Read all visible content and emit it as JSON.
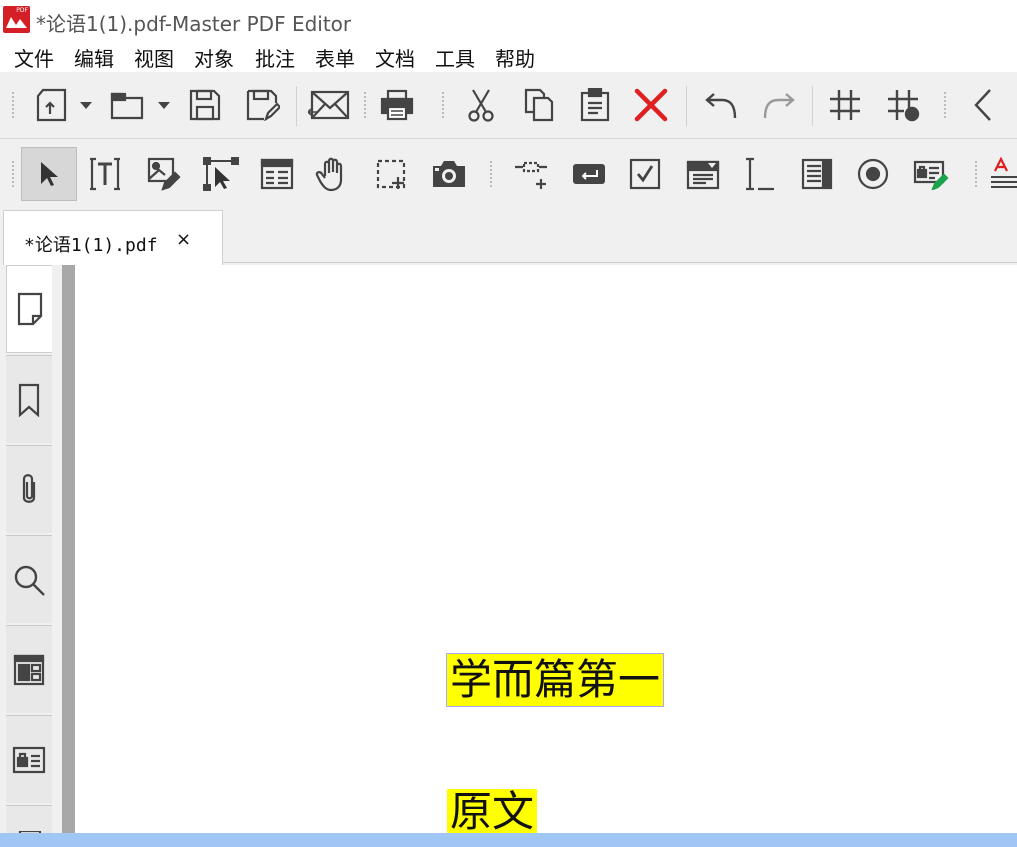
{
  "window": {
    "title": "*论语1(1).pdf-Master PDF Editor"
  },
  "menu": [
    "文件",
    "编辑",
    "视图",
    "对象",
    "批注",
    "表单",
    "文档",
    "工具",
    "帮助"
  ],
  "toolbar_main_icons": [
    "new-document-icon",
    "open-folder-icon",
    "save-icon",
    "save-as-icon",
    "email-icon",
    "print-icon",
    "cut-icon",
    "copy-icon",
    "paste-icon",
    "delete-icon",
    "undo-icon",
    "redo-icon",
    "grid-icon",
    "snap-to-grid-icon",
    "collapse-arrow-icon"
  ],
  "toolbar_tools_icons": [
    "select-pointer-icon",
    "text-edit-icon",
    "image-edit-icon",
    "object-select-icon",
    "form-table-icon",
    "hand-pan-icon",
    "marquee-select-icon",
    "snapshot-camera-icon",
    "link-insert-icon",
    "button-field-icon",
    "checkbox-field-icon",
    "combobox-field-icon",
    "text-field-icon",
    "listbox-field-icon",
    "radio-button-icon",
    "signature-field-icon",
    "text-annotation-icon"
  ],
  "tab": {
    "label": "*论语1(1).pdf",
    "close": "×"
  },
  "sidebar": [
    "pages-icon",
    "bookmarks-icon",
    "attachments-icon",
    "search-icon",
    "layers-icon",
    "signatures-icon",
    "more-panels-icon"
  ],
  "document": {
    "title": "学而篇第一",
    "subtitle": "原文",
    "highlight_color": "#ffff00"
  },
  "colors": {
    "brand": "#d41f26",
    "delete": "#e02020",
    "statusbar": "#9fc6f4"
  }
}
